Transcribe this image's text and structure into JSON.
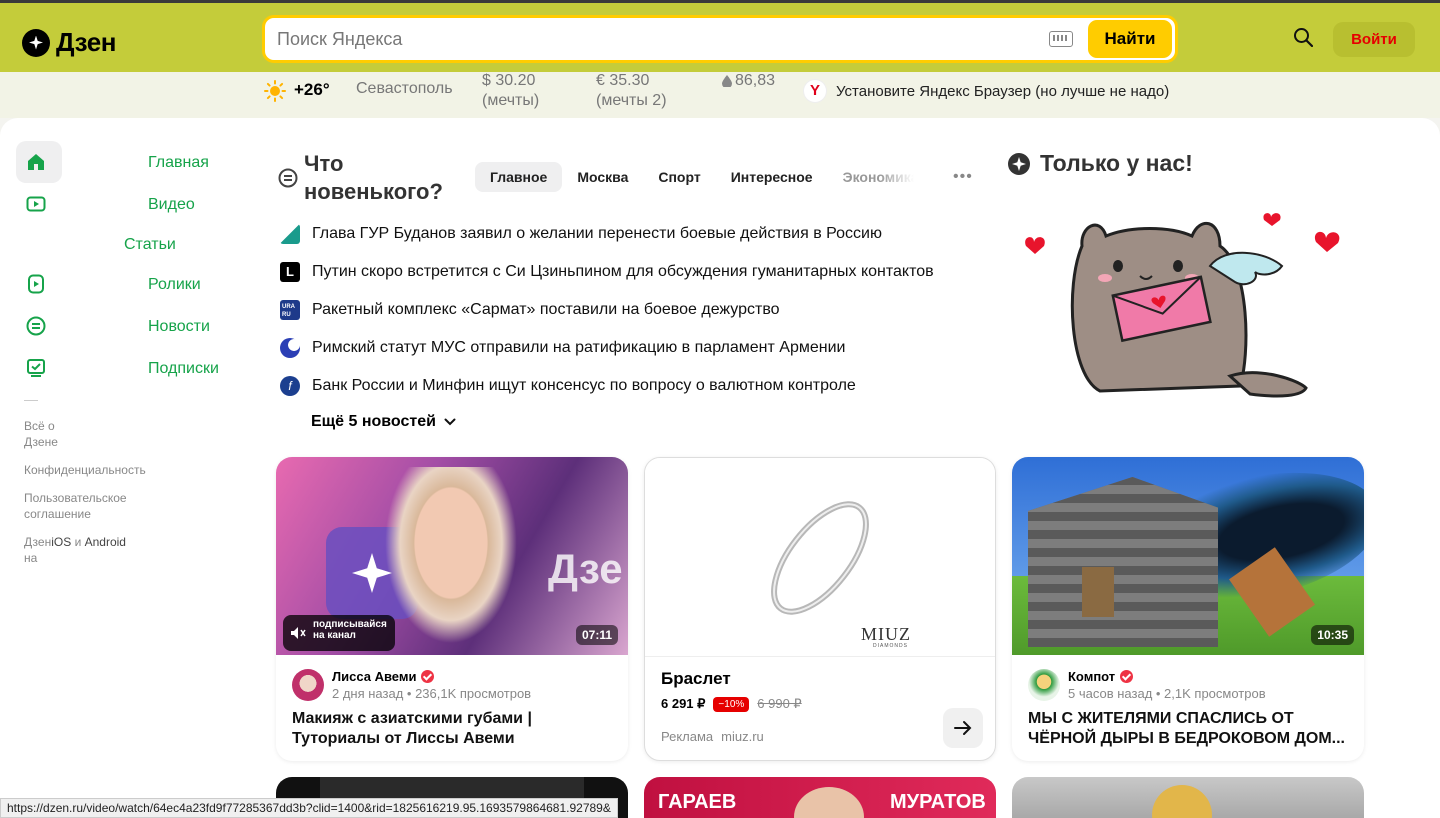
{
  "header": {
    "logo": "Дзен",
    "search_placeholder": "Поиск Яндекса",
    "search_button": "Найти",
    "login_button": "Войти"
  },
  "infobar": {
    "temperature": "+26°",
    "city": "Севастополь",
    "usd": "$ 30.20",
    "usd_note": "(мечты)",
    "eur": "€ 35.30",
    "eur_note": "(мечты 2)",
    "oil": "86,83",
    "browser_promo": "Установите Яндекс Браузер (но лучше не надо)"
  },
  "nav": {
    "items": [
      {
        "label": "Главная",
        "icon": "home-icon"
      },
      {
        "label": "Видео",
        "icon": "video-icon"
      },
      {
        "label": "Статьи",
        "icon": "articles-icon"
      },
      {
        "label": "Ролики",
        "icon": "clips-icon"
      },
      {
        "label": "Новости",
        "icon": "news-icon"
      },
      {
        "label": "Подписки",
        "icon": "subscriptions-icon"
      }
    ],
    "footer": {
      "about": "Всё о Дзене",
      "privacy": "Конфиденциальность",
      "terms": "Пользовательское соглашение",
      "apps_prefix": "Дзен",
      "apps_ios": "iOS",
      "apps_and": "и",
      "apps_android": "Android",
      "apps_suffix": "на"
    }
  },
  "news": {
    "title_line1": "Что",
    "title_line2": "новенького?",
    "tabs": [
      "Главное",
      "Москва",
      "Спорт",
      "Интересное",
      "Экономика"
    ],
    "items": [
      {
        "text": "Глава ГУР Буданов заявил о желании перенести боевые действия в Россию",
        "source_color": "#1a9b8c"
      },
      {
        "text": "Путин скоро встретится с Си Цзиньпином для обсуждения гуманитарных контактов",
        "source_color": "#000000"
      },
      {
        "text": "Ракетный комплекс «Сармат» поставили на боевое дежурство",
        "source_color": "#1e3a8a"
      },
      {
        "text": "Римский статут МУС отправили на ратификацию в парламент Армении",
        "source_color": "#2b3fb5"
      },
      {
        "text": "Банк России и Минфин ищут консенсус по вопросу о валютном контроле",
        "source_color": "#1c3f8f"
      }
    ],
    "more": "Ещё 5 новостей"
  },
  "exclusive": {
    "title": "Только у нас!"
  },
  "cards": [
    {
      "type": "video",
      "duration": "07:11",
      "overlay": "подписывайся на канал",
      "thumb_text": "Дзе",
      "author": "Лисса Авеми",
      "meta": "2 дня назад • 236,1K просмотров",
      "title": "Макияж с азиатскими губами | Туториалы от Лиссы Авеми"
    },
    {
      "type": "ad",
      "brand": "MIUZ",
      "brand_sub": "DIAMONDS",
      "product": "Браслет",
      "price": "6 291 ₽",
      "discount": "−10%",
      "old_price": "6 990 ₽",
      "ad_label": "Реклама",
      "domain": "miuz.ru"
    },
    {
      "type": "video",
      "duration": "10:35",
      "author": "Компот",
      "meta": "5 часов назад • 2,1K просмотров",
      "title": "МЫ С ЖИТЕЛЯМИ СПАСЛИСЬ ОТ ЧЁРНОЙ ДЫРЫ В БЕДРОКОВОМ ДОМ..."
    }
  ],
  "bottom_cards": {
    "middle_left": "ГАРАЕВ",
    "middle_right": "МУРАТОВ"
  },
  "status_url": "https://dzen.ru/video/watch/64ec4a23fd9f77285367dd3b?clid=1400&rid=1825616219.95.1693579864681.92789&",
  "colors": {
    "accent": "#ffcc00",
    "header_bg": "#c4cc3a",
    "nav_green": "#16a34a",
    "login_red": "#e60000"
  }
}
